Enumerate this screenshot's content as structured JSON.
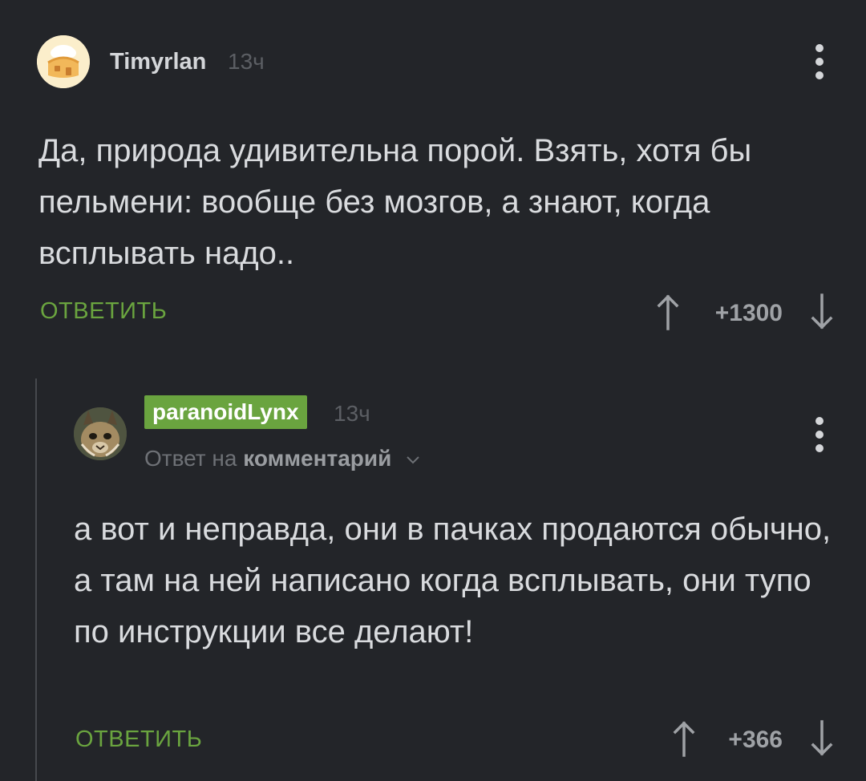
{
  "comments": [
    {
      "username": "Timyrlan",
      "time": "13ч",
      "text": "Да, природа удивительна порой. Взять, хотя бы пельмени: вообще без мозгов, а знают, когда всплывать надо..",
      "reply_label": "ОТВЕТИТЬ",
      "rating": "+1300",
      "avatar_icon": "bread-house-avatar"
    },
    {
      "username": "paranoidLynx",
      "time": "13ч",
      "reply_to_prefix": "Ответ на",
      "reply_to_target": "комментарий",
      "text": "а вот и неправда, они в пачках продаются обычно, а там на ней написано когда всплывать, они тупо по инструкции все делают!",
      "reply_label": "ОТВЕТИТЬ",
      "rating": "+366",
      "avatar_icon": "lynx-photo-avatar"
    }
  ],
  "colors": {
    "background": "#232529",
    "accent_green": "#6aa43f",
    "text": "#d9dbde",
    "muted": "#5c5f64"
  }
}
